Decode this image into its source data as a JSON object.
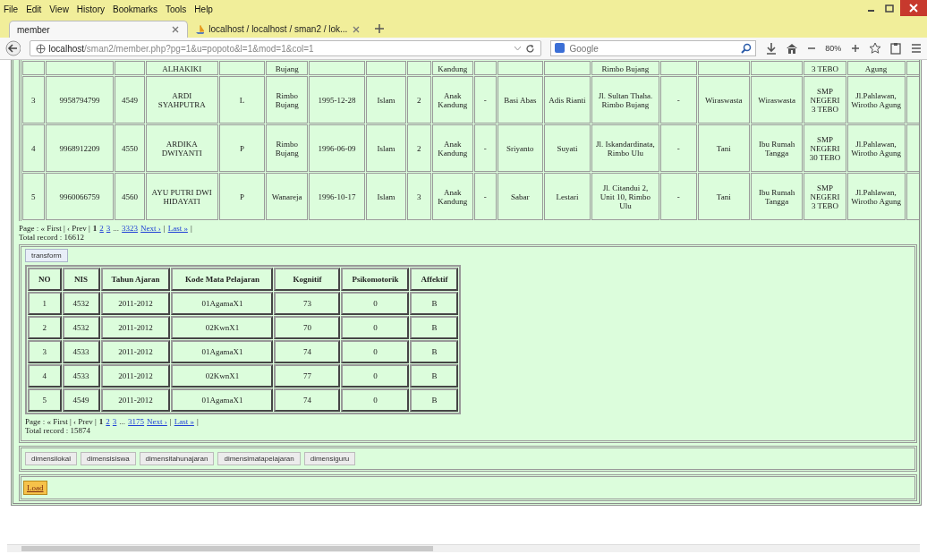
{
  "menu": [
    "File",
    "Edit",
    "View",
    "History",
    "Bookmarks",
    "Tools",
    "Help"
  ],
  "tabs": [
    {
      "label": "member",
      "selected": true
    },
    {
      "label": "localhost / localhost / sman2 / lok...",
      "selected": false
    }
  ],
  "address": {
    "host": "localhost",
    "path": "/sman2/member.php?pg=1&u=popoto&l=1&mod=1&col=1"
  },
  "search": {
    "placeholder": "Google"
  },
  "zoom": "80%",
  "top_table": {
    "rows": [
      [
        null,
        null,
        null,
        "ALHAKIKI",
        null,
        "Bujang",
        null,
        null,
        null,
        "Kandung",
        null,
        null,
        null,
        "Rimbo Bujang",
        null,
        null,
        null,
        "3 TEBO",
        "Agung"
      ],
      [
        "3",
        "9958794799",
        "4549",
        "ARDI SYAHPUTRA",
        "L",
        "Rimbo Bujang",
        "1995-12-28",
        "Islam",
        "2",
        "Anak Kandung",
        "-",
        "Basi Abas",
        "Adis Rianti",
        "Jl. Sultan Thaha. Rimbo Bujang",
        "-",
        "Wiraswasta",
        "Wiraswasta",
        "SMP NEGERI 3 TEBO",
        "Jl.Pahlawan, Wirotho Agung"
      ],
      [
        "4",
        "9968912209",
        "4550",
        "ARDIKA DWIYANTI",
        "P",
        "Rimbo Bujang",
        "1996-06-09",
        "Islam",
        "2",
        "Anak Kandung",
        "-",
        "Sriyanto",
        "Suyati",
        "Jl. Iskandardinata, Rimbo Ulu",
        "-",
        "Tani",
        "Ibu Rumah Tangga",
        "SMP NEGERI 30 TEBO",
        "Jl.Pahlawan, Wirotho Agung"
      ],
      [
        "5",
        "9960066759",
        "4560",
        "AYU PUTRI DWI HIDAYATI",
        "P",
        "Wanareja",
        "1996-10-17",
        "Islam",
        "3",
        "Anak Kandung",
        "-",
        "Sabar",
        "Lestari",
        "Jl. Citandui 2, Unit 10, Rimbo Ulu",
        "-",
        "Tani",
        "Ibu Rumah Tangga",
        "SMP NEGERI 3 TEBO",
        "Jl.Pahlawan, Wirotho Agung"
      ]
    ],
    "pager": [
      {
        "kind": "text",
        "text": "Page : « First | ‹ Prev |"
      },
      {
        "kind": "current",
        "text": "1"
      },
      {
        "kind": "link",
        "text": "2"
      },
      {
        "kind": "link",
        "text": "3"
      },
      {
        "kind": "text",
        "text": "..."
      },
      {
        "kind": "link",
        "text": "3323"
      },
      {
        "kind": "link",
        "text": "Next ›"
      },
      {
        "kind": "text",
        "text": "|"
      },
      {
        "kind": "link",
        "text": "Last »"
      },
      {
        "kind": "text",
        "text": "|"
      }
    ],
    "total": "Total record : 16612"
  },
  "transform_button": "transform",
  "grade_table": {
    "columns": [
      "NO",
      "NIS",
      "Tahun Ajaran",
      "Kode Mata Pelajaran",
      "Kognitif",
      "Psikomotorik",
      "Affektif"
    ],
    "rows": [
      [
        "1",
        "4532",
        "2011-2012",
        "01AgamaX1",
        "73",
        "0",
        "B"
      ],
      [
        "2",
        "4532",
        "2011-2012",
        "02KwnX1",
        "70",
        "0",
        "B"
      ],
      [
        "3",
        "4533",
        "2011-2012",
        "01AgamaX1",
        "74",
        "0",
        "B"
      ],
      [
        "4",
        "4533",
        "2011-2012",
        "02KwnX1",
        "77",
        "0",
        "B"
      ],
      [
        "5",
        "4549",
        "2011-2012",
        "01AgamaX1",
        "74",
        "0",
        "B"
      ]
    ],
    "pager": [
      {
        "kind": "text",
        "text": "Page : « First | ‹ Prev |"
      },
      {
        "kind": "current",
        "text": "1"
      },
      {
        "kind": "link",
        "text": "2"
      },
      {
        "kind": "link",
        "text": "3"
      },
      {
        "kind": "text",
        "text": "..."
      },
      {
        "kind": "link",
        "text": "3175"
      },
      {
        "kind": "link",
        "text": "Next ›"
      },
      {
        "kind": "text",
        "text": "|"
      },
      {
        "kind": "link",
        "text": "Last »"
      },
      {
        "kind": "text",
        "text": "|"
      }
    ],
    "total": "Total record : 15874"
  },
  "dimension_buttons": [
    "dimensilokal",
    "dimensisiswa",
    "dimensitahunajaran",
    "dimensimatapelajaran",
    "dimensiguru"
  ],
  "load_button": "Load"
}
